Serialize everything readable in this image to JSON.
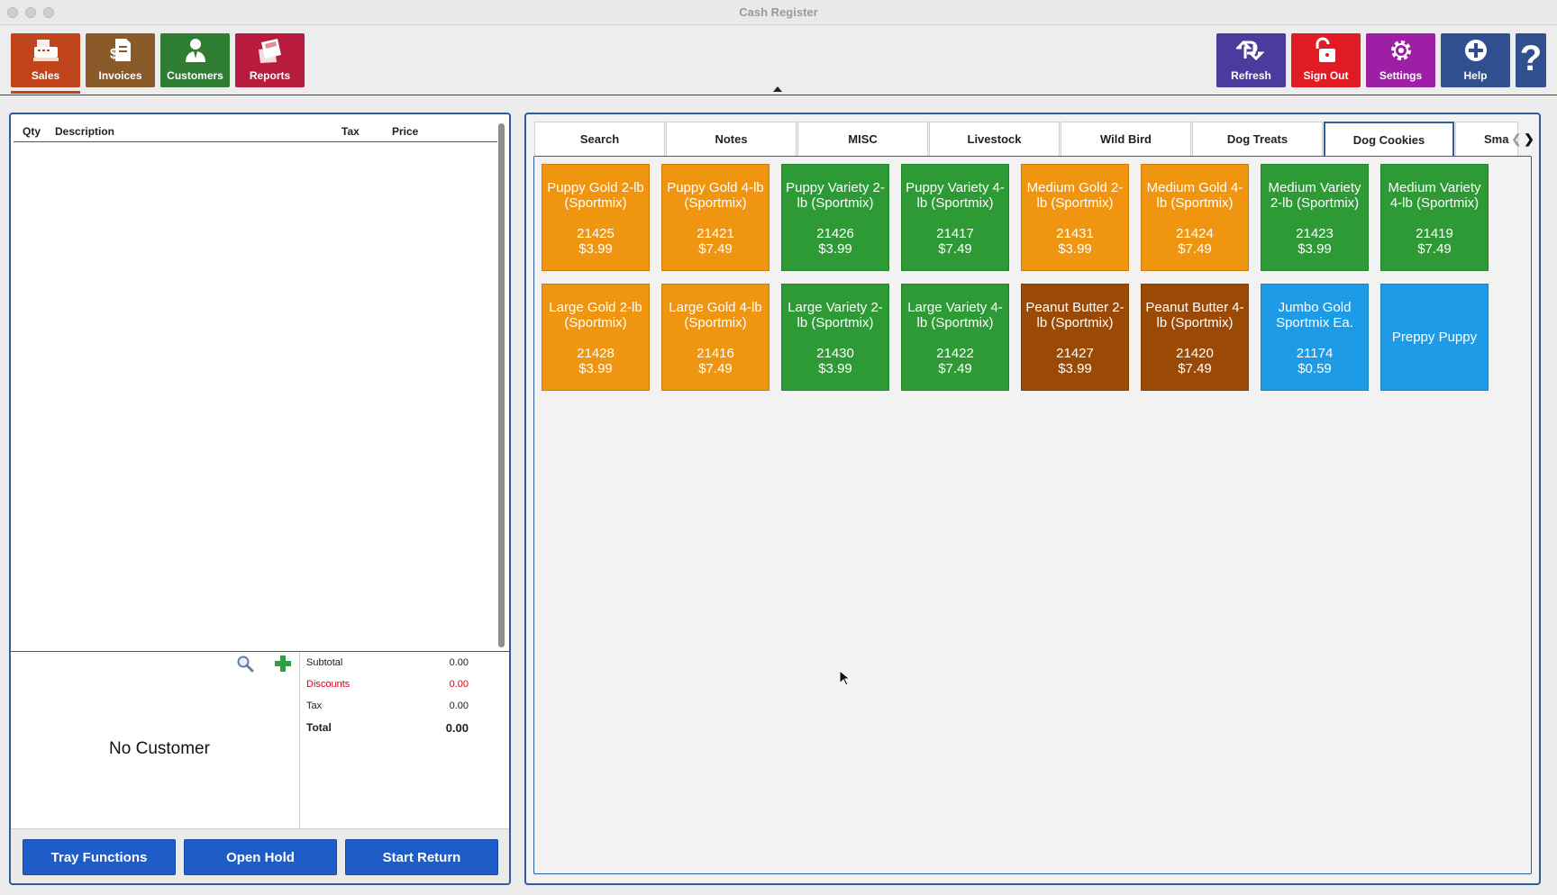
{
  "window": {
    "title": "Cash Register"
  },
  "toolbar": {
    "left_buttons": [
      {
        "label": "Sales",
        "icon": "cash-register-icon",
        "color": "#c0451d"
      },
      {
        "label": "Invoices",
        "icon": "invoice-icon",
        "color": "#8a5a2b"
      },
      {
        "label": "Customers",
        "icon": "customer-icon",
        "color": "#2e7d32"
      },
      {
        "label": "Reports",
        "icon": "reports-icon",
        "color": "#b71c3c"
      }
    ],
    "right_buttons": [
      {
        "label": "Refresh",
        "icon": "refresh-icon",
        "color": "#4a3c9c"
      },
      {
        "label": "Sign Out",
        "icon": "sign-out-icon",
        "color": "#e01b24"
      },
      {
        "label": "Settings",
        "icon": "gear-icon",
        "color": "#9c1fa6"
      },
      {
        "label": "Help",
        "icon": "help-plus-icon",
        "color": "#2f4f8f"
      },
      {
        "label": "?",
        "icon": "question-icon",
        "color": "#2f4f8f"
      }
    ]
  },
  "cart": {
    "columns": [
      "Qty",
      "Description",
      "Tax",
      "Price"
    ],
    "items": []
  },
  "customer": {
    "label": "No Customer"
  },
  "totals": {
    "subtotal_label": "Subtotal",
    "subtotal": "0.00",
    "discounts_label": "Discounts",
    "discounts": "0.00",
    "tax_label": "Tax",
    "tax": "0.00",
    "total_label": "Total",
    "total": "0.00"
  },
  "actions": {
    "tray_functions": "Tray Functions",
    "open_hold": "Open Hold",
    "start_return": "Start Return"
  },
  "tabs": [
    {
      "label": "Search"
    },
    {
      "label": "Notes"
    },
    {
      "label": "MISC"
    },
    {
      "label": "Livestock"
    },
    {
      "label": "Wild Bird"
    },
    {
      "label": "Dog Treats"
    },
    {
      "label": "Dog Cookies",
      "active": true
    },
    {
      "label": "Sma"
    }
  ],
  "colors": {
    "orange": "#f0950f",
    "green": "#2e9a35",
    "brown": "#9b4a05",
    "blue": "#1e9be6",
    "panel_border": "#2f5d9c",
    "action_blue": "#1e5cc8",
    "discount_red": "#d0021b"
  },
  "products": [
    {
      "name": "Puppy Gold 2-lb (Sportmix)",
      "code": "21425",
      "price": "$3.99",
      "color": "orange"
    },
    {
      "name": "Puppy Gold 4-lb (Sportmix)",
      "code": "21421",
      "price": "$7.49",
      "color": "orange"
    },
    {
      "name": "Puppy Variety 2-lb (Sportmix)",
      "code": "21426",
      "price": "$3.99",
      "color": "green"
    },
    {
      "name": "Puppy Variety 4-lb (Sportmix)",
      "code": "21417",
      "price": "$7.49",
      "color": "green"
    },
    {
      "name": "Medium Gold 2-lb (Sportmix)",
      "code": "21431",
      "price": "$3.99",
      "color": "orange"
    },
    {
      "name": "Medium Gold 4-lb (Sportmix)",
      "code": "21424",
      "price": "$7.49",
      "color": "orange"
    },
    {
      "name": "Medium Variety 2-lb (Sportmix)",
      "code": "21423",
      "price": "$3.99",
      "color": "green"
    },
    {
      "name": "Medium Variety 4-lb (Sportmix)",
      "code": "21419",
      "price": "$7.49",
      "color": "green"
    },
    {
      "name": "Large Gold 2-lb (Sportmix)",
      "code": "21428",
      "price": "$3.99",
      "color": "orange"
    },
    {
      "name": "Large Gold 4-lb (Sportmix)",
      "code": "21416",
      "price": "$7.49",
      "color": "orange"
    },
    {
      "name": "Large Variety 2-lb (Sportmix)",
      "code": "21430",
      "price": "$3.99",
      "color": "green"
    },
    {
      "name": "Large Variety 4-lb (Sportmix)",
      "code": "21422",
      "price": "$7.49",
      "color": "green"
    },
    {
      "name": "Peanut Butter 2-lb (Sportmix)",
      "code": "21427",
      "price": "$3.99",
      "color": "brown"
    },
    {
      "name": "Peanut Butter 4-lb (Sportmix)",
      "code": "21420",
      "price": "$7.49",
      "color": "brown"
    },
    {
      "name": "Jumbo Gold Sportmix Ea.",
      "code": "21174",
      "price": "$0.59",
      "color": "blue"
    },
    {
      "name": "Preppy Puppy",
      "code": "",
      "price": "",
      "color": "blue"
    }
  ]
}
